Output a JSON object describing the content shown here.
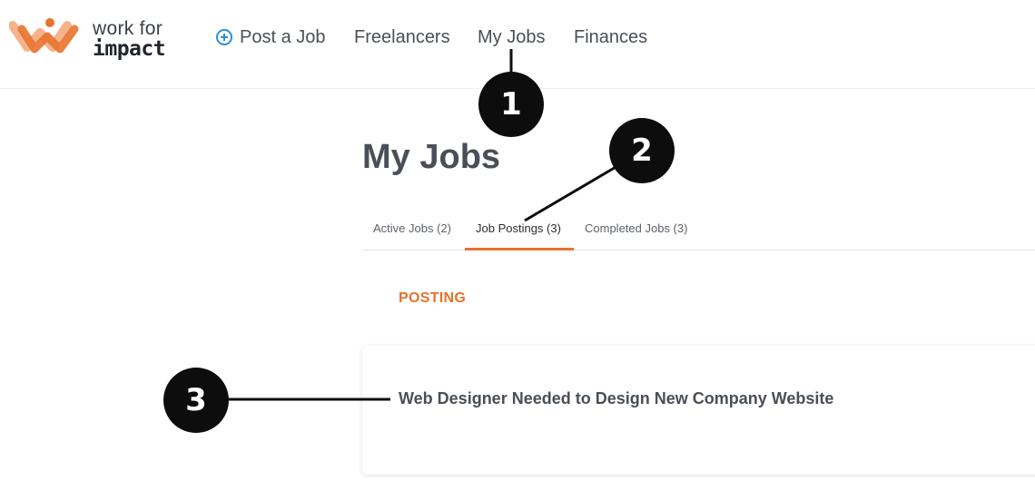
{
  "brand": {
    "logo_line1": "work for",
    "logo_line2": "impact",
    "accent_color": "#e8722c",
    "plus_color": "#2d8fd8"
  },
  "nav": {
    "post_job": "Post a Job",
    "post_job_icon": "plus-circle-icon",
    "freelancers": "Freelancers",
    "my_jobs": "My Jobs",
    "finances": "Finances"
  },
  "page": {
    "title": "My Jobs"
  },
  "tabs": [
    {
      "label": "Active Jobs (2)",
      "active": false
    },
    {
      "label": "Job Postings (3)",
      "active": true
    },
    {
      "label": "Completed Jobs (3)",
      "active": false
    }
  ],
  "section": {
    "label": "POSTING"
  },
  "posting": {
    "title": "Web Designer Needed to Design New Company Website"
  },
  "annotations": {
    "callout_1": "1",
    "callout_2": "2",
    "callout_3": "3"
  }
}
